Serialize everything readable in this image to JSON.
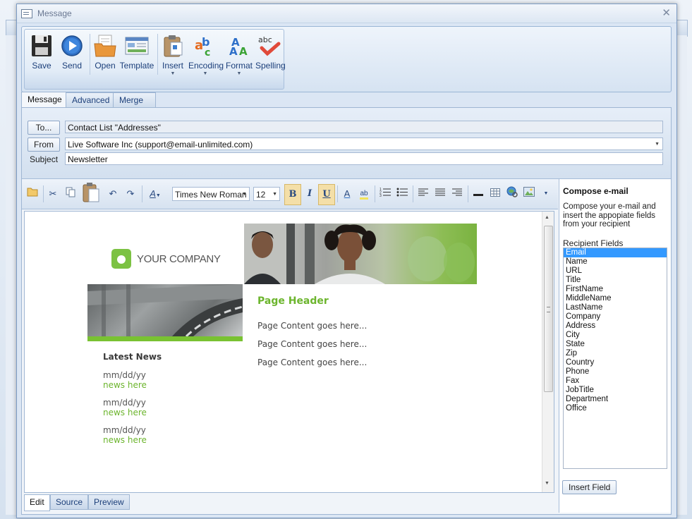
{
  "window": {
    "title": "Message"
  },
  "ribbon": {
    "buttons": [
      {
        "label": "Save",
        "icon": "floppy-disk-icon"
      },
      {
        "label": "Send",
        "icon": "send-arrow-icon"
      },
      {
        "label": "Open",
        "icon": "open-folder-icon"
      },
      {
        "label": "Template",
        "icon": "template-icon"
      },
      {
        "label": "Insert",
        "icon": "clipboard-icon"
      },
      {
        "label": "Encoding",
        "icon": "encoding-icon"
      },
      {
        "label": "Format",
        "icon": "format-text-icon"
      },
      {
        "label": "Spelling",
        "icon": "spell-check-icon"
      }
    ]
  },
  "tabs": [
    "Message",
    "Advanced",
    "Merge Preview"
  ],
  "header": {
    "to_button": "To...",
    "to_value": "Contact List \"Addresses\"",
    "from_button": "From",
    "from_value": "Live Software Inc (support@email-unlimited.com)",
    "subject_label": "Subject",
    "subject_value": "Newsletter"
  },
  "editor_toolbar": {
    "font": "Times New Roman",
    "size": "12",
    "bold": "B",
    "italic": "I",
    "underline": "U"
  },
  "content": {
    "company": "YOUR COMPANY",
    "page_header": "Page Header",
    "page_content": [
      "Page Content goes here...",
      "Page Content goes here...",
      "Page Content goes here..."
    ],
    "latest_news": "Latest News",
    "news": [
      {
        "date": "mm/dd/yy",
        "link": "news here"
      },
      {
        "date": "mm/dd/yy",
        "link": "news here"
      },
      {
        "date": "mm/dd/yy",
        "link": "news here"
      }
    ]
  },
  "bottom_tabs": [
    "Edit",
    "Source",
    "Preview"
  ],
  "sidebar": {
    "title": "Compose e-mail",
    "description": "Compose your e-mail and insert the appopiate fields from your recipient",
    "fields_label": "Recipient Fields",
    "fields": [
      "Email",
      "Name",
      "URL",
      "Title",
      "FirstName",
      "MiddleName",
      "LastName",
      "Company",
      "Address",
      "City",
      "State",
      "Zip",
      "Country",
      "Phone",
      "Fax",
      "JobTitle",
      "Department",
      "Office"
    ],
    "selected": "Email",
    "insert_button": "Insert Field"
  },
  "colors": {
    "accent_green": "#6cb52d",
    "selection_blue": "#3399ff"
  }
}
